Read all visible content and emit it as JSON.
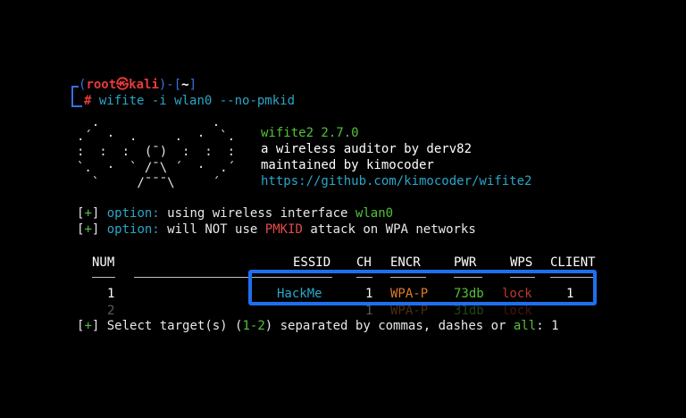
{
  "prompt": {
    "open": "(",
    "user": "root",
    "at": "㉿",
    "host": "kali",
    "close": ")-[",
    "dir": "~",
    "end": "]",
    "hash": "#",
    "command": " wifite -i wlan0 --no-pmkid"
  },
  "logo_lines": [
    "  .               .",
    ".´  ·  .     .  ·  `.",
    ":  :  :  (¯)  :  :  :",
    "`.  ·  ` /¯\\ ´  ·  .´",
    "  `     /¯¯¯\\     ´"
  ],
  "banner": {
    "name": "wifite2 2.7.0",
    "tagline": "a wireless auditor by derv82",
    "maintainer": "maintained by kimocoder",
    "url": "https://github.com/kimocoder/wifite2"
  },
  "options": [
    {
      "prefix": "[+]",
      "plus": "+",
      "label": "option:",
      "text": " using wireless interface ",
      "highlight": "wlan0",
      "rest": ""
    },
    {
      "prefix": "[+]",
      "plus": "+",
      "label": "option:",
      "text": " will NOT use ",
      "highlight": "PMKID",
      "rest": " attack on WPA networks"
    }
  ],
  "table": {
    "headers": {
      "num": "NUM",
      "essid": "ESSID",
      "ch": "CH",
      "encr": "ENCR",
      "pwr": "PWR",
      "wps": "WPS",
      "client": "CLIENT"
    },
    "rows": [
      {
        "num": "1",
        "essid": "HackMe",
        "ch": "1",
        "encr": "WPA-P",
        "pwr": "73db",
        "wps": "lock",
        "client": "1"
      },
      {
        "num": "2",
        "essid": "",
        "ch": "1",
        "encr": "WPA-P",
        "pwr": "31db",
        "wps": "lock",
        "client": ""
      }
    ]
  },
  "select": {
    "open": "[",
    "plus": "+",
    "close": "]",
    "text1": " Select target(s) (",
    "range": "1-2",
    "text2": ") separated by commas, dashes or ",
    "all": "all",
    "text3": ": ",
    "answer": "1"
  },
  "colors": {
    "accent": "#1e6ff0",
    "prompt_blue": "#3a6fe0",
    "green": "#53c23a",
    "cyan": "#2aa6c8",
    "orange": "#e07a2a"
  }
}
